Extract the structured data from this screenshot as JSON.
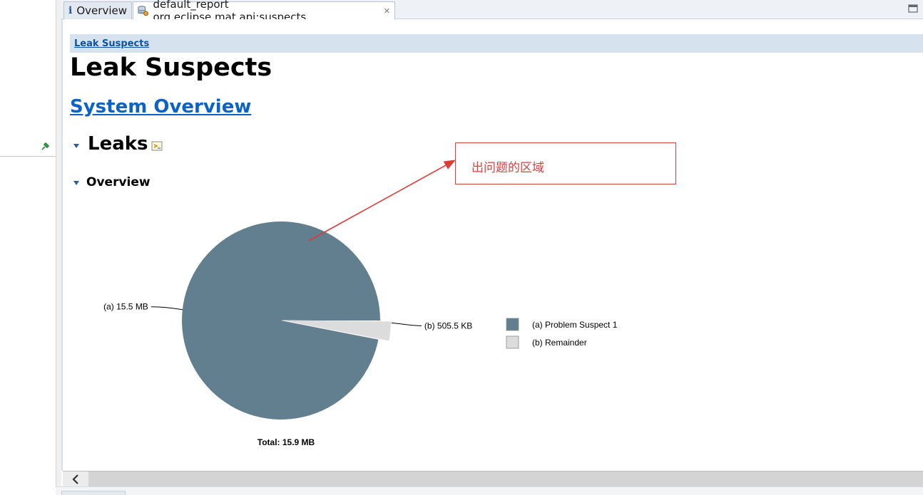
{
  "tabs": [
    {
      "label": "Overview",
      "icon": "info-icon"
    },
    {
      "label": "default_report  org.eclipse.mat.api:suspects",
      "icon": "database-report-icon",
      "close_icon": "close-icon"
    }
  ],
  "breadcrumb": {
    "label": "Leak Suspects"
  },
  "page": {
    "title": "Leak Suspects",
    "system_overview_link": "System Overview",
    "leaks_heading": "Leaks",
    "overview_heading": "Overview"
  },
  "annotation": {
    "text": "出问题的区域",
    "color": "#d9413f"
  },
  "colors": {
    "problem": "#617f8e",
    "remainder": "#dcdcdc",
    "link": "#0b63c5"
  },
  "chart_data": {
    "type": "pie",
    "slices": [
      {
        "id": "a",
        "label": "(a)  15.5 MB",
        "legend": "(a)  Problem Suspect 1",
        "value": 15.5,
        "unit": "MB",
        "color": "#617f8e"
      },
      {
        "id": "b",
        "label": "(b)  505.5 KB",
        "legend": "(b)  Remainder",
        "value": 0.4937,
        "unit": "MB",
        "color": "#dcdcdc"
      }
    ],
    "total_label": "Total: 15.9 MB",
    "legend_position": "right"
  }
}
